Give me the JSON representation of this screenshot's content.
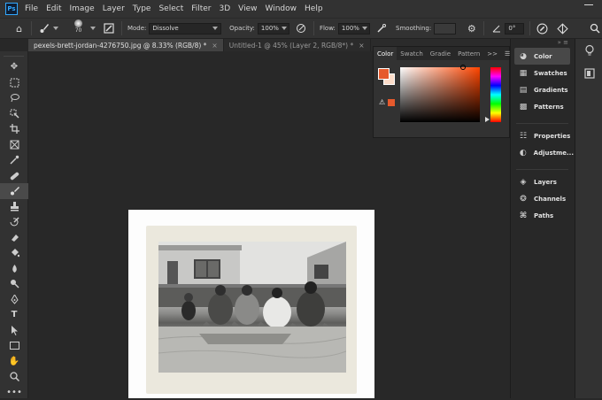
{
  "app": {
    "logo_text": "Ps"
  },
  "menu": [
    "File",
    "Edit",
    "Image",
    "Layer",
    "Type",
    "Select",
    "Filter",
    "3D",
    "View",
    "Window",
    "Help"
  ],
  "options": {
    "brush_size": "70",
    "mode_label": "Mode:",
    "mode_value": "Dissolve",
    "opacity_label": "Opacity:",
    "opacity_value": "100%",
    "flow_label": "Flow:",
    "flow_value": "100%",
    "smoothing_label": "Smoothing:",
    "smoothing_value": "",
    "angle_value": "0°"
  },
  "tabs": [
    {
      "label": "pexels-brett-jordan-4276750.jpg @ 8.33% (RGB/8) *",
      "active": true
    },
    {
      "label": "Untitled-1 @ 45% (Layer 2, RGB/8*) *",
      "active": false
    }
  ],
  "color_panel": {
    "tabs": [
      "Color",
      "Swatch",
      "Gradie",
      "Pattern"
    ],
    "foreground": "#e65a2d",
    "background": "#fbdcc9"
  },
  "dock": {
    "group1": [
      "Color",
      "Swatches",
      "Gradients",
      "Patterns"
    ],
    "group2": [
      "Properties",
      "Adjustme..."
    ],
    "group3": [
      "Layers",
      "Channels",
      "Paths"
    ]
  },
  "tools": [
    "move-icon",
    "marquee-icon",
    "lasso-icon",
    "quick-select-icon",
    "crop-icon",
    "frame-icon",
    "eyedropper-icon",
    "healing-icon",
    "brush-icon",
    "stamp-icon",
    "history-brush-icon",
    "eraser-icon",
    "paint-bucket-icon",
    "blur-icon",
    "dodge-icon",
    "pen-icon",
    "type-icon",
    "path-select-icon",
    "rectangle-icon",
    "hand-icon",
    "zoom-icon",
    "more-icon"
  ]
}
